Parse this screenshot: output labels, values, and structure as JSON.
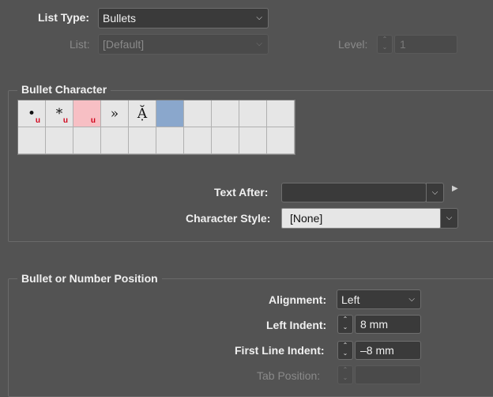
{
  "list_type": {
    "label": "List Type:",
    "value": "Bullets"
  },
  "list": {
    "label": "List:",
    "value": "[Default]"
  },
  "level": {
    "label": "Level:",
    "value": "1"
  },
  "bullet_character": {
    "title": "Bullet Character",
    "row1": [
      {
        "glyph": "•",
        "unicode_mark": "u",
        "bg": "#e6e6e6"
      },
      {
        "glyph": "*",
        "unicode_mark": "u",
        "bg": "#e6e6e6"
      },
      {
        "glyph": "",
        "unicode_mark": "u",
        "bg": "#f7bfc4"
      },
      {
        "glyph": "»",
        "unicode_mark": "",
        "bg": "#e6e6e6"
      },
      {
        "glyph": "Ặ",
        "unicode_mark": "",
        "bg": "#e6e6e6"
      },
      {
        "glyph": "",
        "unicode_mark": "",
        "bg": "#8aa7cc"
      },
      {
        "glyph": "",
        "unicode_mark": "",
        "bg": "#e6e6e6"
      },
      {
        "glyph": "",
        "unicode_mark": "",
        "bg": "#e6e6e6"
      },
      {
        "glyph": "",
        "unicode_mark": "",
        "bg": "#e6e6e6"
      },
      {
        "glyph": "",
        "unicode_mark": "",
        "bg": "#e6e6e6"
      }
    ],
    "text_after": {
      "label": "Text After:",
      "value": ""
    },
    "character_style": {
      "label": "Character Style:",
      "value": "[None]"
    }
  },
  "position": {
    "title": "Bullet or Number Position",
    "alignment": {
      "label": "Alignment:",
      "value": "Left"
    },
    "left_indent": {
      "label": "Left Indent:",
      "value": "8 mm"
    },
    "first_line_indent": {
      "label": "First Line Indent:",
      "value": "–8 mm"
    },
    "tab_position": {
      "label": "Tab Position:",
      "value": ""
    }
  },
  "icons": {
    "chevron": "chevron-down-icon",
    "stepper": "stepper-icon",
    "flyout": "triangle-right-icon"
  }
}
